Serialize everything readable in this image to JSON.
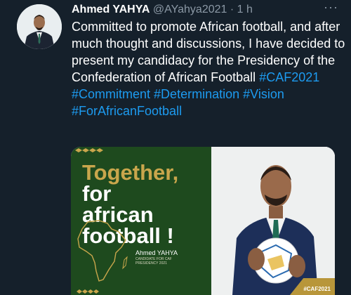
{
  "tweet": {
    "author_name": "Ahmed YAHYA",
    "handle": "@AYahya2021",
    "separator": " · ",
    "time": "1 h",
    "more_label": "···",
    "text_plain": "Committed to promote African football, and after much thought and discussions, I have decided to present my candidacy for the Presidency of the Confederation of African Football",
    "hashtags": [
      "#CAF2021",
      "#Commitment",
      "#Determination",
      "#Vision",
      "#ForAfricanFootball"
    ]
  },
  "media": {
    "headline_line1": "Together,",
    "headline_line2": "for",
    "headline_line3": "african",
    "headline_line4": "football !",
    "candidate_name": "Ahmed YAHYA",
    "candidate_sub": "CANDIDATE FOR CAF PRESIDENCY 2021",
    "badge": "#CAF2021"
  },
  "colors": {
    "background": "#15202b",
    "hashtag": "#1d9bf0",
    "muted": "#8b98a5",
    "poster_green": "#1e4a1e",
    "poster_gold": "#c9a64c"
  },
  "icons": {
    "more": "ellipsis-icon",
    "africa": "africa-map-icon",
    "avatar": "profile-photo"
  }
}
